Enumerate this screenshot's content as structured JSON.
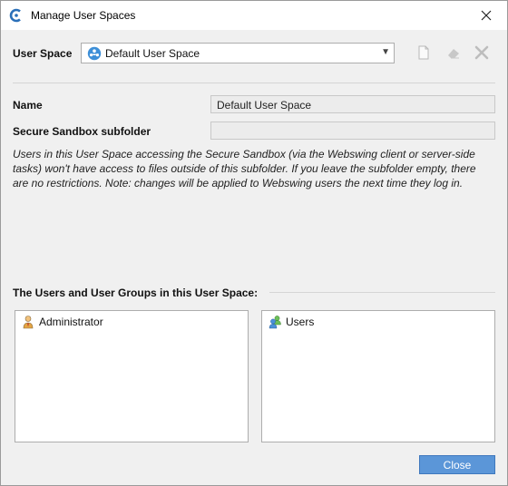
{
  "window": {
    "title": "Manage User Spaces"
  },
  "user_space": {
    "label": "User Space",
    "selected": "Default User Space"
  },
  "toolbar": {
    "new_icon": "new-document-icon",
    "rename_icon": "eraser-icon",
    "delete_icon": "delete-icon"
  },
  "form": {
    "name_label": "Name",
    "name_value": "Default User Space",
    "sandbox_label": "Secure Sandbox subfolder",
    "sandbox_value": "",
    "note": "Users in this User Space accessing the Secure Sandbox (via the Webswing client or server-side tasks) won't have access to files outside of this subfolder. If you leave the subfolder empty, there are no restrictions. Note: changes will be applied to Webswing users the next time they log in."
  },
  "members": {
    "heading": "The Users and User Groups in this User Space:",
    "users": [
      "Administrator"
    ],
    "groups": [
      "Users"
    ]
  },
  "footer": {
    "close_label": "Close"
  },
  "colors": {
    "accent": "#5b96d8"
  }
}
